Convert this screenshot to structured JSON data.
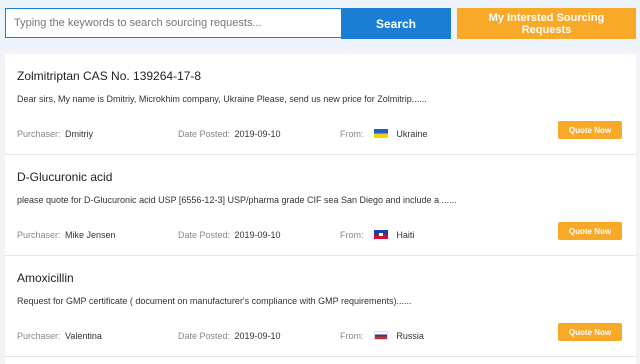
{
  "search": {
    "placeholder": "Typing the keywords to search sourcing requests...",
    "value": "",
    "button_label": "Search"
  },
  "interested_button_label": "My Intersted Sourcing Requests",
  "labels": {
    "purchaser": "Purchaser:",
    "date_posted": "Date Posted:",
    "from": "From:",
    "quote": "Quote Now"
  },
  "requests": [
    {
      "title": "Zolmitriptan CAS No. 139264-17-8",
      "description": "Dear sirs, My name is Dmitriy, Microkhim company, Ukraine Please, send us new price for Zolmitrip......",
      "purchaser": "Dmitriy",
      "date": "2019-09-10",
      "country": "Ukraine",
      "flag_icon": "ukraine-flag-icon"
    },
    {
      "title": "D-Glucuronic acid",
      "description": "please quote for D-Glucuronic acid USP [6556-12-3] USP/pharma grade CIF sea San Diego and include a ......",
      "purchaser": "Mike Jensen",
      "date": "2019-09-10",
      "country": "Haiti",
      "flag_icon": "haiti-flag-icon"
    },
    {
      "title": "Amoxicillin",
      "description": "Request for GMP certificate ( document on manufacturer's compliance with GMP requirements)......",
      "purchaser": "Valentina",
      "date": "2019-09-10",
      "country": "Russia",
      "flag_icon": "russia-flag-icon"
    }
  ],
  "colors": {
    "primary_blue": "#1a7fd4",
    "accent_orange": "#f8a928",
    "page_background": "#f3f4f6"
  }
}
